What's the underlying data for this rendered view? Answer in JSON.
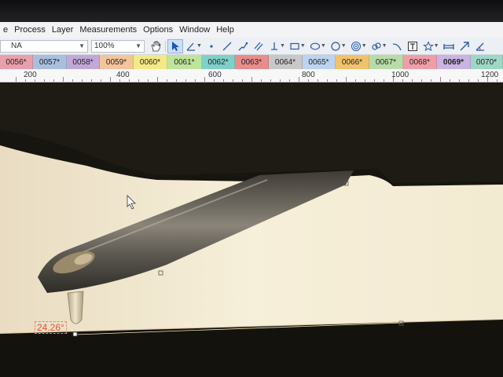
{
  "menubar": {
    "items": [
      "e",
      "Process",
      "Layer",
      "Measurements",
      "Options",
      "Window",
      "Help"
    ]
  },
  "toolbar": {
    "layer_select": "NA",
    "zoom_select": "100%",
    "tools": [
      "hand-icon",
      "pointer-icon",
      "angle-icon",
      "point-icon",
      "line-icon",
      "polyline-icon",
      "parallel-lines-icon",
      "perpendicular-icon",
      "rectangle-icon",
      "ellipse-icon",
      "circle-icon",
      "concentric-circles-icon",
      "link-icon",
      "arc-icon",
      "text-icon",
      "star-icon",
      "scale-icon",
      "arrow-icon",
      "angle-measure-icon"
    ]
  },
  "tabs": [
    {
      "label": "0056*",
      "color": "#e8a0ac"
    },
    {
      "label": "0057*",
      "color": "#a9bfe0"
    },
    {
      "label": "0058*",
      "color": "#c2a8d8"
    },
    {
      "label": "0059*",
      "color": "#f4c59a"
    },
    {
      "label": "0060*",
      "color": "#f3ea86"
    },
    {
      "label": "0061*",
      "color": "#bfe49c"
    },
    {
      "label": "0062*",
      "color": "#7fd0c8"
    },
    {
      "label": "0063*",
      "color": "#e98c8c"
    },
    {
      "label": "0064*",
      "color": "#c8c8c8"
    },
    {
      "label": "0065*",
      "color": "#bcd4f0"
    },
    {
      "label": "0066*",
      "color": "#f1c26b"
    },
    {
      "label": "0067*",
      "color": "#b8dca8"
    },
    {
      "label": "0068*",
      "color": "#ef9ea8"
    },
    {
      "label": "0069*",
      "color": "#c9b4e4"
    },
    {
      "label": "0070*",
      "color": "#9ed7c6"
    }
  ],
  "active_tab": "0069*",
  "ruler": {
    "labels": [
      "200",
      "400",
      "600",
      "800",
      "1000",
      "1200"
    ]
  },
  "measurement": {
    "angle": "24.26°"
  }
}
